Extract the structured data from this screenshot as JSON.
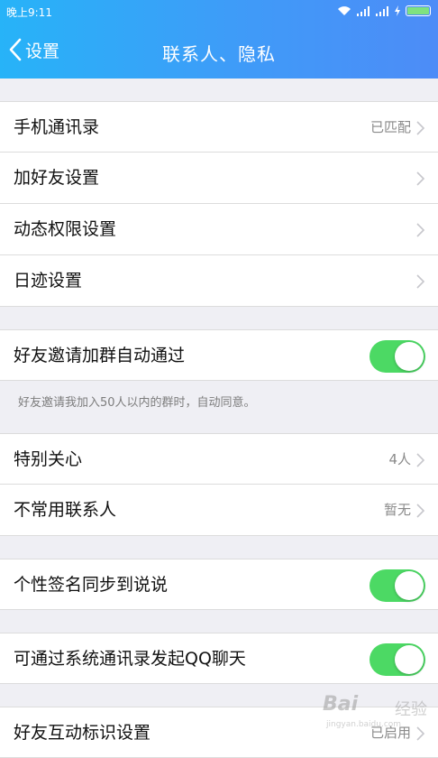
{
  "status_bar": {
    "time": "晚上9:11"
  },
  "header": {
    "back_label": "设置",
    "title": "联系人、隐私"
  },
  "sections": {
    "contacts": [
      {
        "label": "手机通讯录",
        "value": "已匹配"
      },
      {
        "label": "加好友设置",
        "value": ""
      },
      {
        "label": "动态权限设置",
        "value": ""
      },
      {
        "label": "日迹设置",
        "value": ""
      }
    ],
    "group_invite": {
      "label": "好友邀请加群自动通过",
      "enabled": true,
      "note": "好友邀请我加入50人以内的群时，自动同意。"
    },
    "special": [
      {
        "label": "特别关心",
        "value": "4人"
      },
      {
        "label": "不常用联系人",
        "value": "暂无"
      }
    ],
    "signature_sync": {
      "label": "个性签名同步到说说",
      "enabled": true
    },
    "qq_chat": {
      "label": "可通过系统通讯录发起QQ聊天",
      "enabled": true
    },
    "interaction": {
      "label": "好友互动标识设置",
      "value": "已启用"
    }
  },
  "watermark": {
    "logo": "Bai",
    "sub": "经验",
    "url": "jingyan.baidu.com"
  },
  "colors": {
    "accent": "#3aa3f8",
    "toggle_on": "#4cd964"
  }
}
